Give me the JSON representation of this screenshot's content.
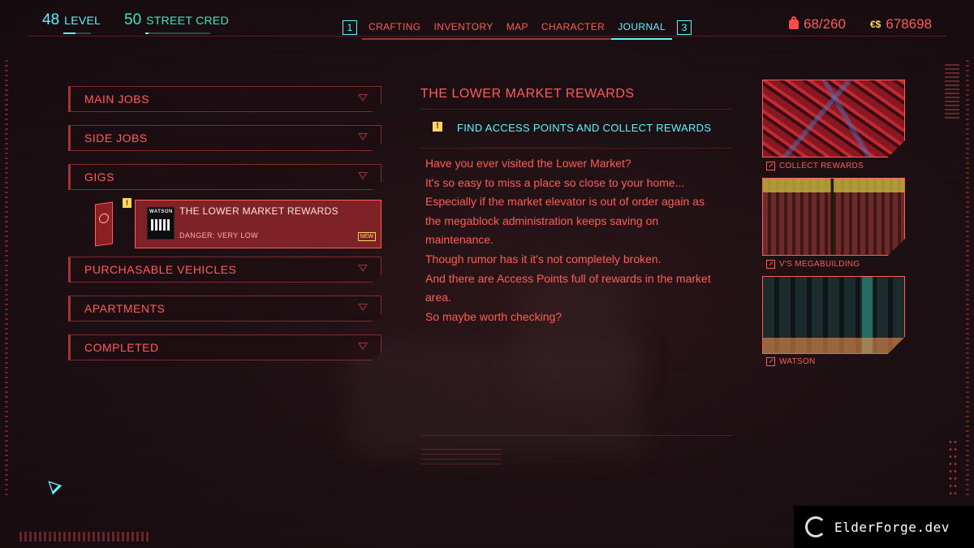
{
  "header": {
    "level": {
      "value": "48",
      "label": "LEVEL",
      "progress": 0.45
    },
    "street_cred": {
      "value": "50",
      "label": "STREET CRED",
      "progress": 0.05
    },
    "tabs": {
      "left_key": "1",
      "right_key": "3",
      "items": [
        {
          "label": "CRAFTING",
          "active": false
        },
        {
          "label": "INVENTORY",
          "active": false
        },
        {
          "label": "MAP",
          "active": false
        },
        {
          "label": "CHARACTER",
          "active": false
        },
        {
          "label": "JOURNAL",
          "active": true
        }
      ]
    },
    "carry_weight": "68/260",
    "currency_symbol": "€$",
    "money": "678698"
  },
  "journal": {
    "categories": [
      {
        "label": "MAIN JOBS"
      },
      {
        "label": "SIDE JOBS"
      },
      {
        "label": "GIGS"
      },
      {
        "label": "PURCHASABLE VEHICLES"
      },
      {
        "label": "APARTMENTS"
      },
      {
        "label": "COMPLETED"
      }
    ],
    "selected_job": {
      "thumb_text": "WATSON",
      "title": "THE LOWER MARKET REWARDS",
      "danger": "DANGER: VERY LOW",
      "badge": "NEW",
      "alert": "!"
    }
  },
  "detail": {
    "title": "THE LOWER MARKET REWARDS",
    "objective_icon": "!",
    "objective": "FIND ACCESS POINTS AND COLLECT REWARDS",
    "lines": [
      "Have you ever visited the Lower Market?",
      "It's so easy to miss a place so close to your home...",
      "Especially if the market elevator is out of order again as",
      "the megablock administration keeps saving on",
      "maintenance.",
      "Though rumor has it it's not completely broken.",
      "And there are Access Points full of rewards in the market",
      "area.",
      "So maybe worth checking?"
    ]
  },
  "cards": [
    {
      "caption": "COLLECT REWARDS"
    },
    {
      "caption": "V'S MEGABUILDING"
    },
    {
      "caption": "WATSON"
    }
  ],
  "watermark": "ElderForge.dev",
  "colors": {
    "accent_red": "#ff5d58",
    "accent_cyan": "#5ef6ff",
    "accent_yellow": "#ffd75e",
    "selected_bg": "#7e2227"
  }
}
